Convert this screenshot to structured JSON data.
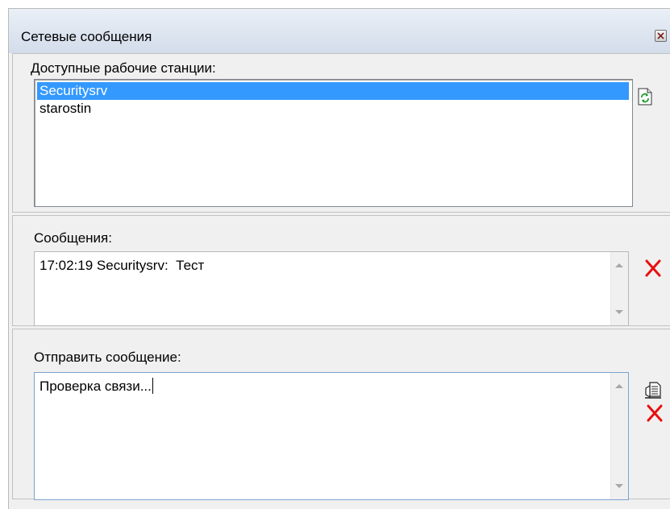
{
  "window": {
    "title": "Сетевые сообщения",
    "close_icon": "close-icon"
  },
  "workstations": {
    "label": "Доступные рабочие станции:",
    "items": [
      {
        "name": "Securitysrv",
        "selected": true
      },
      {
        "name": "starostin",
        "selected": false
      }
    ],
    "refresh_icon": "refresh-icon"
  },
  "messages": {
    "label": "Сообщения:",
    "text": "17:02:19 Securitysrv:  Тест",
    "clear_icon": "delete-x-icon"
  },
  "send": {
    "label": "Отправить сообщение:",
    "text": "Проверка связи...",
    "send_icon": "send-document-icon",
    "clear_icon": "delete-x-icon"
  },
  "colors": {
    "selection": "#3399ff",
    "delete": "#e81010",
    "refresh": "#1f9e2f"
  }
}
